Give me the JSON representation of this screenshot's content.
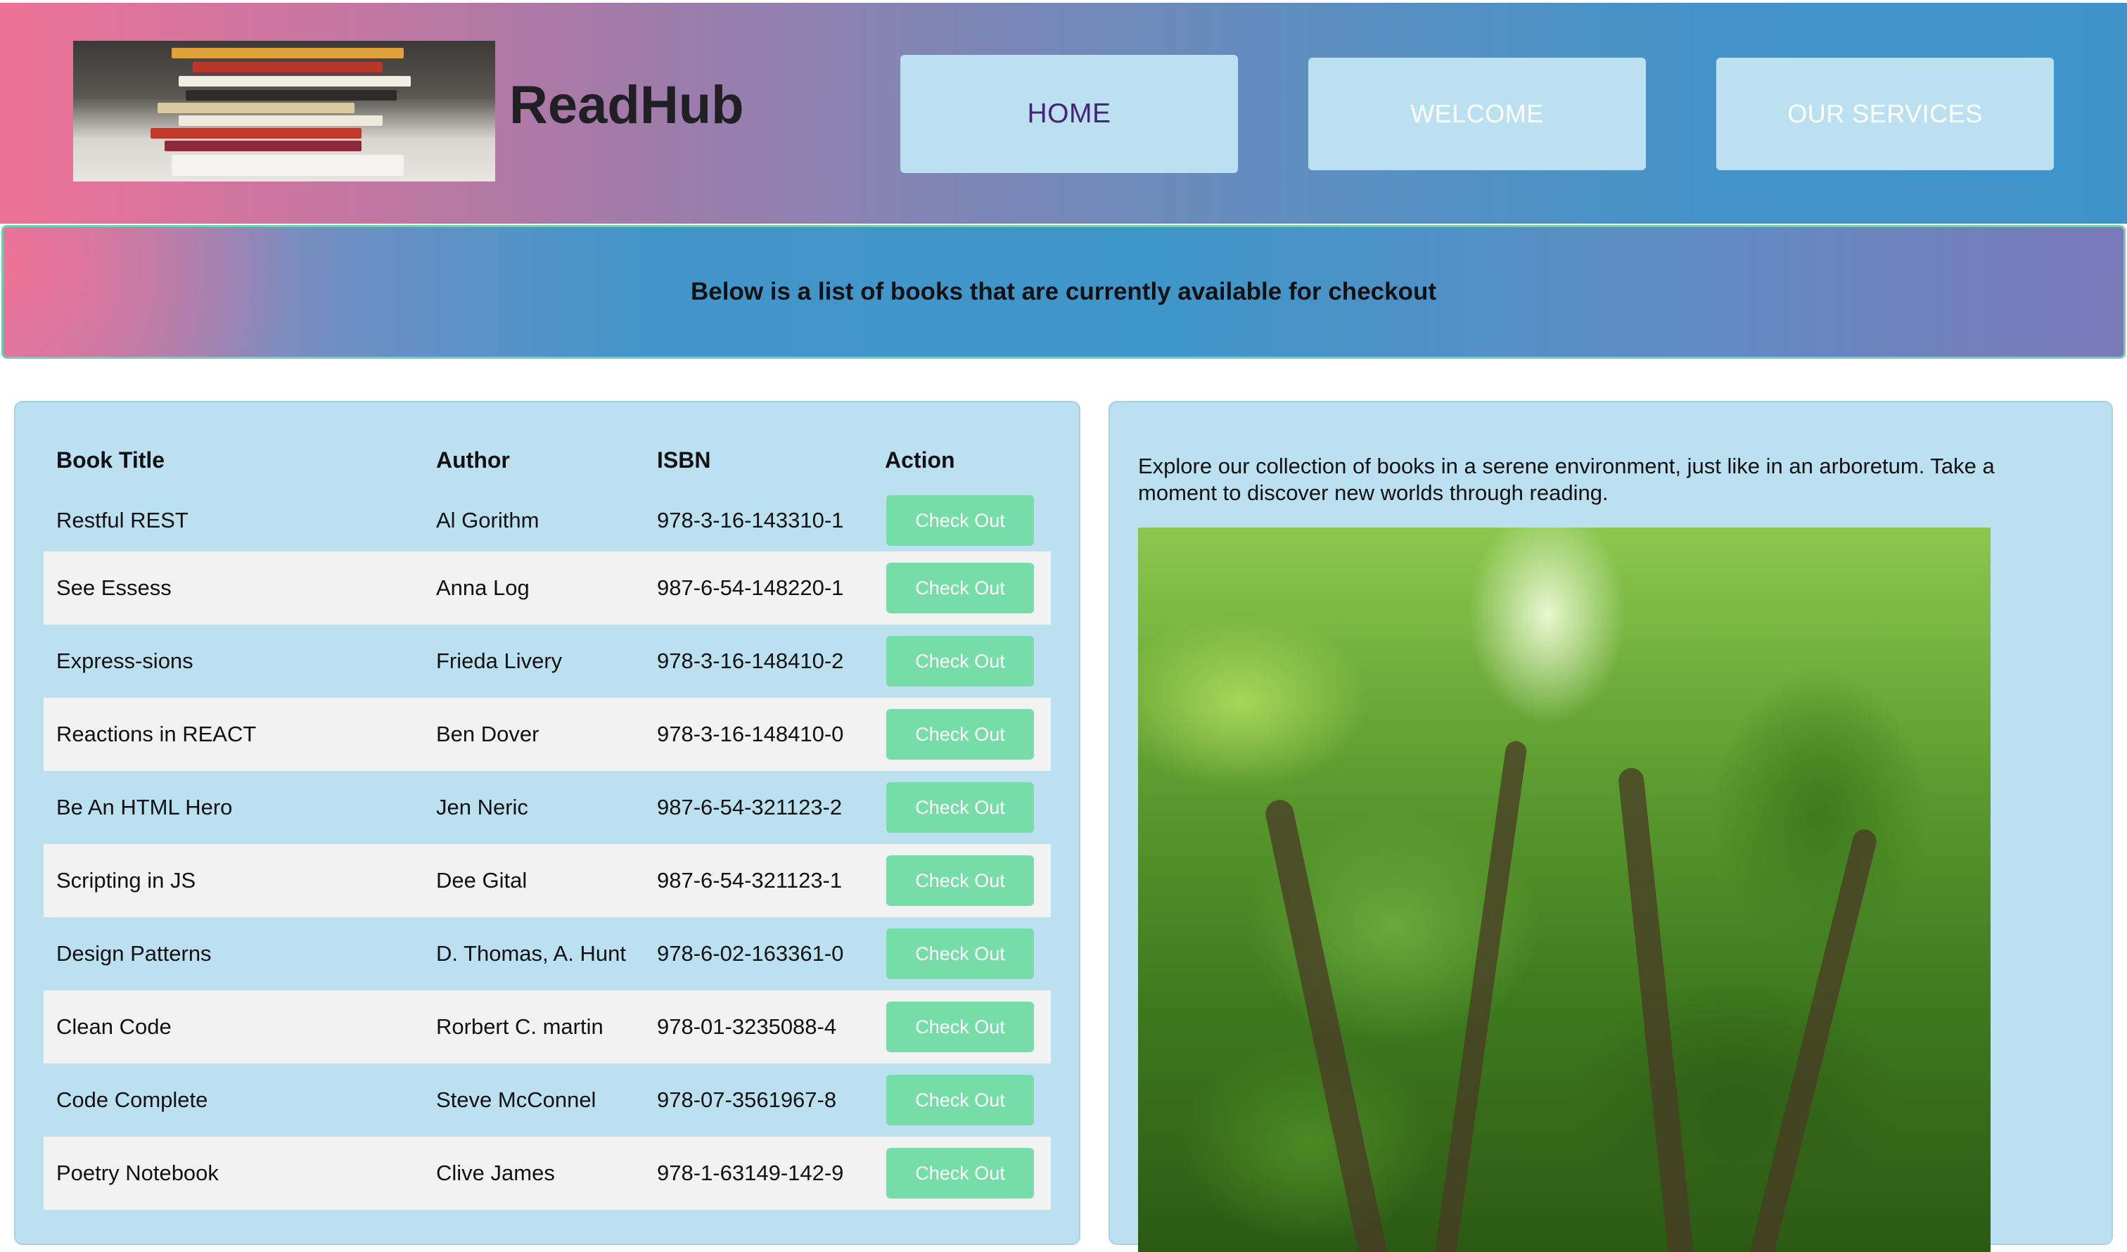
{
  "header": {
    "brand": "ReadHub",
    "nav": [
      {
        "label": "HOME",
        "active": true
      },
      {
        "label": "WELCOME",
        "active": false
      },
      {
        "label": "OUR SERVICES",
        "active": false
      }
    ]
  },
  "banner": {
    "text": "Below is a list of books that are currently available for checkout"
  },
  "table": {
    "headers": [
      "Book Title",
      "Author",
      "ISBN",
      "Action"
    ],
    "button_label": "Check Out",
    "rows": [
      {
        "title": "Restful REST",
        "author": "Al Gorithm",
        "isbn": "978-3-16-143310-1"
      },
      {
        "title": "See Essess",
        "author": "Anna Log",
        "isbn": "987-6-54-148220-1"
      },
      {
        "title": "Express-sions",
        "author": "Frieda Livery",
        "isbn": "978-3-16-148410-2"
      },
      {
        "title": "Reactions in REACT",
        "author": "Ben Dover",
        "isbn": "978-3-16-148410-0"
      },
      {
        "title": "Be An HTML Hero",
        "author": "Jen Neric",
        "isbn": "987-6-54-321123-2"
      },
      {
        "title": "Scripting in JS",
        "author": "Dee Gital",
        "isbn": "987-6-54-321123-1"
      },
      {
        "title": "Design Patterns",
        "author": "D. Thomas, A. Hunt",
        "isbn": "978-6-02-163361-0"
      },
      {
        "title": "Clean Code",
        "author": "Rorbert C. martin",
        "isbn": "978-01-3235088-4"
      },
      {
        "title": "Code Complete",
        "author": "Steve McConnel",
        "isbn": "978-07-3561967-8"
      },
      {
        "title": "Poetry Notebook",
        "author": "Clive James",
        "isbn": "978-1-63149-142-9"
      }
    ]
  },
  "aside": {
    "text": "Explore our collection of books in a serene environment, just like in an arboretum. Take a moment to discover new worlds through reading."
  },
  "colors": {
    "panel": "#bbe0f0",
    "checkout_button": "#76dda8",
    "active_nav_text": "#45237a"
  }
}
